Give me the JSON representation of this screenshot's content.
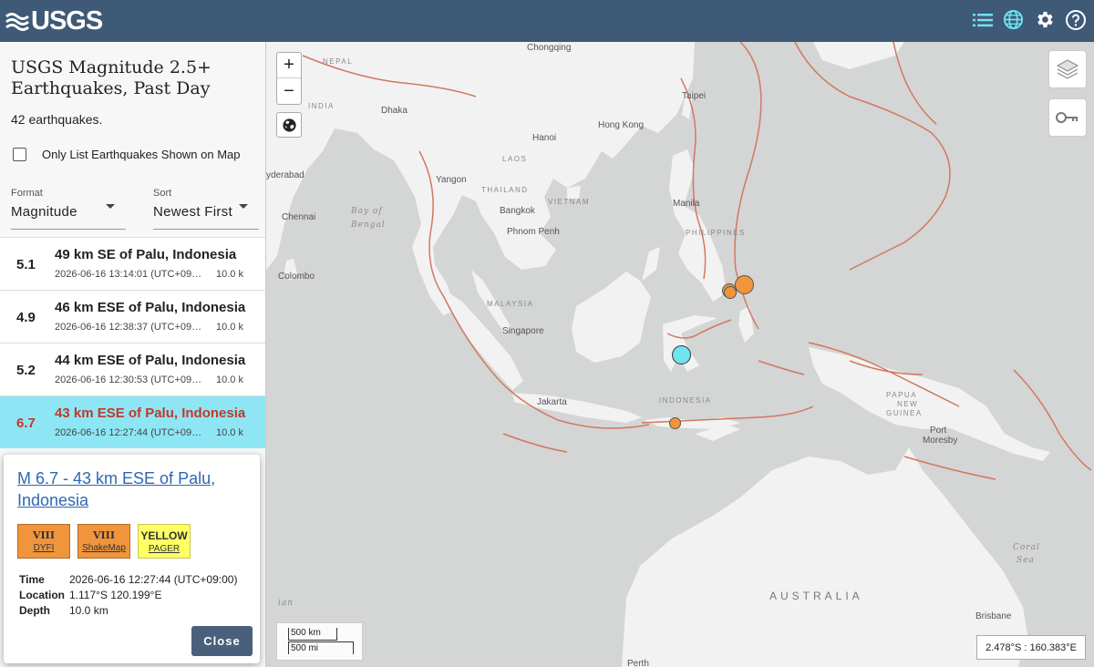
{
  "header": {
    "logo_text": "USGS",
    "icons": [
      "list-icon",
      "globe-icon",
      "gear-icon",
      "help-icon"
    ]
  },
  "sidebar": {
    "title": "USGS Magnitude 2.5+ Earthquakes, Past Day",
    "count_text": "42 earthquakes.",
    "filter_label": "Only List Earthquakes Shown on Map",
    "format": {
      "label": "Format",
      "value": "Magnitude"
    },
    "sort": {
      "label": "Sort",
      "value": "Newest First"
    },
    "earthquakes": [
      {
        "mag": "5.1",
        "place": "49 km SE of Palu, Indonesia",
        "time": "2026-06-16 13:14:01 (UTC+09…",
        "depth": "10.0 k"
      },
      {
        "mag": "4.9",
        "place": "46 km ESE of Palu, Indonesia",
        "time": "2026-06-16 12:38:37 (UTC+09…",
        "depth": "10.0 k"
      },
      {
        "mag": "5.2",
        "place": "44 km ESE of Palu, Indonesia",
        "time": "2026-06-16 12:30:53 (UTC+09…",
        "depth": "10.0 k"
      },
      {
        "mag": "6.7",
        "place": "43 km ESE of Palu, Indonesia",
        "time": "2026-06-16 12:27:44 (UTC+09…",
        "depth": "10.0 k"
      }
    ]
  },
  "popup": {
    "title": "M 6.7 - 43 km ESE of Palu, Indonesia",
    "badges": [
      {
        "value": "VIII",
        "label": "DYFI",
        "color": "#f0953b"
      },
      {
        "value": "VIII",
        "label": "ShakeMap",
        "color": "#f0953b"
      },
      {
        "value": "YELLOW",
        "label": "PAGER",
        "color": "#ffff66"
      }
    ],
    "details": [
      {
        "key": "Time",
        "value": "2026-06-16 12:27:44 (UTC+09:00)"
      },
      {
        "key": "Location",
        "value": "1.117°S 120.199°E"
      },
      {
        "key": "Depth",
        "value": "10.0 km"
      }
    ],
    "close_label": "Close"
  },
  "map": {
    "zoom_in": "+",
    "zoom_out": "−",
    "scale_km": "500 km",
    "scale_mi": "500 mi",
    "coords": "2.478°S : 160.383°E",
    "labels": {
      "chongqing": "Chongqing",
      "nepal": "NEPAL",
      "taipei": "Taipei",
      "dhaka": "Dhaka",
      "india": "INDIA",
      "hong_kong": "Hong Kong",
      "hanoi": "Hanoi",
      "laos": "LAOS",
      "hyderabad": "yderabad",
      "yangon": "Yangon",
      "thailand": "THAILAND",
      "vietnam": "VIETNAM",
      "manila": "Manila",
      "chennai": "Chennai",
      "bay_of_bengal_1": "Bay of",
      "bay_of_bengal_2": "Bengal",
      "bangkok": "Bangkok",
      "phnom_penh": "Phnom Penh",
      "philippines": "PHILIPPINES",
      "colombo": "Colombo",
      "malaysia": "MALAYSIA",
      "singapore": "Singapore",
      "jakarta": "Jakarta",
      "indonesia": "INDONESIA",
      "papua_1": "PAPUA",
      "papua_2": "NEW",
      "papua_3": "GUINEA",
      "port_1": "Port",
      "port_2": "Moresby",
      "coral_1": "Coral",
      "coral_2": "Sea",
      "australia": "AUSTRALIA",
      "brisbane": "Brisbane",
      "perth": "Perth",
      "indian_ocean": "ian"
    }
  }
}
